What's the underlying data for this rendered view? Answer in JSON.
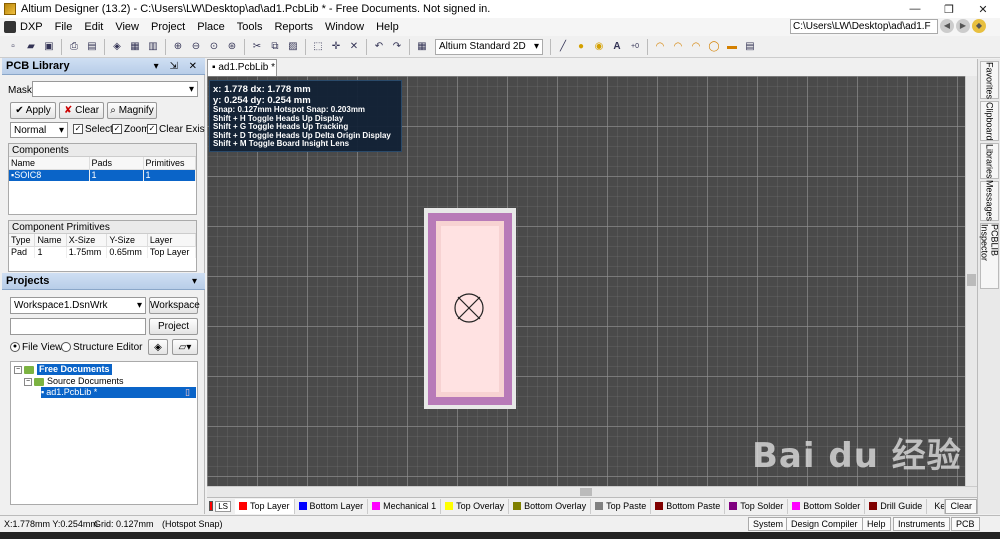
{
  "window": {
    "title": "Altium Designer (13.2) - C:\\Users\\LW\\Desktop\\ad\\ad1.PcbLib * - Free Documents. Not signed in.",
    "min": "—",
    "max": "❐",
    "close": "✕"
  },
  "menu": {
    "dxp": "DXP",
    "items": [
      "File",
      "Edit",
      "View",
      "Project",
      "Place",
      "Tools",
      "Reports",
      "Window",
      "Help"
    ],
    "path": "C:\\Users\\LW\\Desktop\\ad\\ad1.F"
  },
  "toolbar": {
    "view_mode": "Altium Standard 2D"
  },
  "pcb_library": {
    "header": "PCB Library",
    "mask_label": "Mask",
    "apply": "Apply",
    "clear": "Clear",
    "magnify": "Magnify",
    "mode": "Normal",
    "select": "Select",
    "zoom": "Zoom",
    "clear_existing": "Clear Existin",
    "components": {
      "title": "Components",
      "headers": [
        "Name",
        "Pads",
        "Primitives"
      ],
      "rows": [
        {
          "name": "SOIC8",
          "pads": "1",
          "primitives": "1"
        }
      ]
    },
    "primitives": {
      "title": "Component Primitives",
      "headers": [
        "Type",
        "Name",
        "X-Size",
        "Y-Size",
        "Layer"
      ],
      "rows": [
        {
          "type": "Pad",
          "name": "1",
          "xsize": "1.75mm",
          "ysize": "0.65mm",
          "layer": "Top Layer"
        }
      ]
    }
  },
  "projects": {
    "header": "Projects",
    "workspace_select": "Workspace1.DsnWrk",
    "workspace_btn": "Workspace",
    "project_btn": "Project",
    "file_view": "File View",
    "structure_editor": "Structure Editor",
    "tree": {
      "root": "Free Documents",
      "folder": "Source Documents",
      "file": "ad1.PcbLib *"
    }
  },
  "document": {
    "tab": "ad1.PcbLib *"
  },
  "hud": {
    "line1": "x:  1.778    dx:  1.778 mm",
    "line2": "y:  0.254    dy:  0.254 mm",
    "line3": "Snap: 0.127mm Hotspot Snap: 0.203mm",
    "line4": "Shift + H   Toggle Heads Up Display",
    "line5": "Shift + G   Toggle Heads Up Tracking",
    "line6": "Shift + D   Toggle Heads Up Delta Origin Display",
    "line7": "Shift + M  Toggle Board Insight Lens"
  },
  "right_tabs": [
    "Favorites",
    "Clipboard",
    "Libraries",
    "Messages",
    "PCBLIB Inspector"
  ],
  "layers": {
    "ls": "LS",
    "tabs": [
      {
        "name": "Top Layer",
        "color": "#ff0000"
      },
      {
        "name": "Bottom Layer",
        "color": "#0000ff"
      },
      {
        "name": "Mechanical 1",
        "color": "#ff00ff"
      },
      {
        "name": "Top Overlay",
        "color": "#ffff00"
      },
      {
        "name": "Bottom Overlay",
        "color": "#808000"
      },
      {
        "name": "Top Paste",
        "color": "#808080"
      },
      {
        "name": "Bottom Paste",
        "color": "#800000"
      },
      {
        "name": "Top Solder",
        "color": "#800080"
      },
      {
        "name": "Bottom Solder",
        "color": "#ff00ff"
      },
      {
        "name": "Drill Guide",
        "color": "#800000"
      },
      {
        "name": "Keep-Out Layer",
        "color": "#ff00ff"
      }
    ],
    "clear": "Clear"
  },
  "status": {
    "coords": "X:1.778mm Y:0.254mm",
    "grid": "Grid: 0.127mm",
    "snap": "(Hotspot Snap)",
    "buttons": [
      "System",
      "Design Compiler",
      "Help",
      "Instruments",
      "PCB"
    ]
  },
  "watermark": "Bai du 经验"
}
